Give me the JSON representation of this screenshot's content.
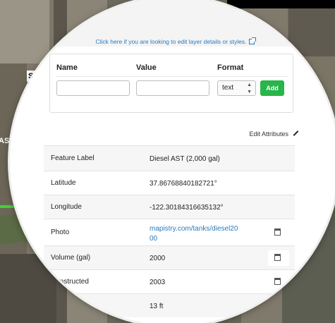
{
  "map": {
    "label_s": "S",
    "label_ast": "AST"
  },
  "panel": {
    "edit_layer_link": "Click here if you are looking to edit layer details or styles.",
    "form": {
      "name_header": "Name",
      "value_header": "Value",
      "format_header": "Format",
      "name_value": "",
      "value_value": "",
      "format_selected": "text",
      "add_label": "Add"
    },
    "edit_attributes_label": "Edit Attributes",
    "attributes": [
      {
        "key": "Feature Label",
        "value": "Diesel AST (2,000 gal)",
        "link": false,
        "deletable": false
      },
      {
        "key": "Latitude",
        "value": "37.86768840182721°",
        "link": false,
        "deletable": false
      },
      {
        "key": "Longitude",
        "value": "-122.30184316635132°",
        "link": false,
        "deletable": false
      },
      {
        "key": "Photo",
        "value": "mapistry.com/tanks/diesel2000",
        "link": true,
        "deletable": true
      },
      {
        "key": "Volume (gal)",
        "value": "2000",
        "link": false,
        "deletable": true
      },
      {
        "key": "Constructed",
        "value": "2003",
        "link": false,
        "deletable": true
      },
      {
        "key": "",
        "value": "13 ft",
        "link": false,
        "deletable": false
      }
    ]
  }
}
